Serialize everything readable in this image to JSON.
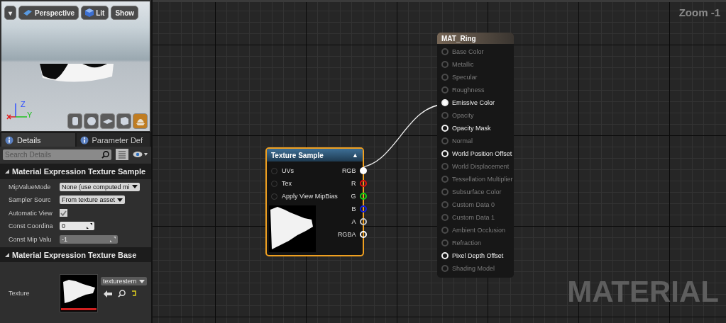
{
  "viewport": {
    "menu_label": "▾",
    "view_mode": "Perspective",
    "lighting": "Lit",
    "show": "Show",
    "axis_labels": [
      "Z",
      "Y"
    ],
    "preview_shapes": [
      {
        "selected": false
      },
      {
        "selected": false
      },
      {
        "selected": false
      },
      {
        "selected": false
      },
      {
        "selected": true
      }
    ]
  },
  "details": {
    "tabs": [
      {
        "label": "Details",
        "selected": true
      },
      {
        "label": "Parameter Def",
        "selected": false
      }
    ],
    "search": {
      "placeholder": "Search Details"
    },
    "sections": [
      {
        "title": "Material Expression Texture Sample",
        "expanded": true,
        "properties": [
          {
            "kind": "dropdown",
            "label": "MipValueMode",
            "value": "None (use computed mi",
            "disabled": false
          },
          {
            "kind": "dropdown",
            "label": "Sampler Sourc",
            "value": "From texture asset",
            "disabled": false
          },
          {
            "kind": "checkbox",
            "label": "Automatic View",
            "checked": true,
            "disabled": false
          },
          {
            "kind": "number",
            "label": "Const Coordina",
            "value": "0",
            "disabled": false
          },
          {
            "kind": "number",
            "label": "Const Mip Valu",
            "value": "-1",
            "disabled": true
          }
        ]
      },
      {
        "title": "Material Expression Texture Base",
        "expanded": true,
        "properties": [
          {
            "kind": "texture",
            "label": "Texture",
            "value": "texturestern",
            "disabled": false
          }
        ]
      }
    ]
  },
  "graph": {
    "zoom_label": "Zoom -1",
    "watermark": "MATERIAL",
    "texture_node": {
      "title": "Texture Sample",
      "collapse": "▲",
      "selected": true,
      "inputs": [
        {
          "label": "UVs",
          "connected": false
        },
        {
          "label": "Tex",
          "connected": false
        },
        {
          "label": "Apply View MipBias",
          "connected": false
        }
      ],
      "outputs": [
        {
          "label": "RGB",
          "connected": true,
          "color": "#ffffff"
        },
        {
          "label": "R",
          "connected": false,
          "color": "#e01010"
        },
        {
          "label": "G",
          "connected": false,
          "color": "#10d010"
        },
        {
          "label": "B",
          "connected": false,
          "color": "#1020e0"
        },
        {
          "label": "A",
          "connected": false,
          "color": "#c8c8c8"
        },
        {
          "label": "RGBA",
          "connected": false,
          "color": "#ffffff"
        }
      ]
    },
    "material_node": {
      "title": "MAT_Ring",
      "inputs": [
        {
          "label": "Base Color",
          "enabled": false,
          "connected": false
        },
        {
          "label": "Metallic",
          "enabled": false,
          "connected": false
        },
        {
          "label": "Specular",
          "enabled": false,
          "connected": false
        },
        {
          "label": "Roughness",
          "enabled": false,
          "connected": false
        },
        {
          "label": "Emissive Color",
          "enabled": true,
          "connected": true
        },
        {
          "label": "Opacity",
          "enabled": false,
          "connected": false
        },
        {
          "label": "Opacity Mask",
          "enabled": true,
          "connected": false
        },
        {
          "label": "Normal",
          "enabled": false,
          "connected": false
        },
        {
          "label": "World Position Offset",
          "enabled": true,
          "connected": false
        },
        {
          "label": "World Displacement",
          "enabled": false,
          "connected": false
        },
        {
          "label": "Tessellation Multiplier",
          "enabled": false,
          "connected": false
        },
        {
          "label": "Subsurface Color",
          "enabled": false,
          "connected": false
        },
        {
          "label": "Custom Data 0",
          "enabled": false,
          "connected": false
        },
        {
          "label": "Custom Data 1",
          "enabled": false,
          "connected": false
        },
        {
          "label": "Ambient Occlusion",
          "enabled": false,
          "connected": false
        },
        {
          "label": "Refraction",
          "enabled": false,
          "connected": false
        },
        {
          "label": "Pixel Depth Offset",
          "enabled": true,
          "connected": false
        },
        {
          "label": "Shading Model",
          "enabled": false,
          "connected": false
        }
      ]
    }
  }
}
